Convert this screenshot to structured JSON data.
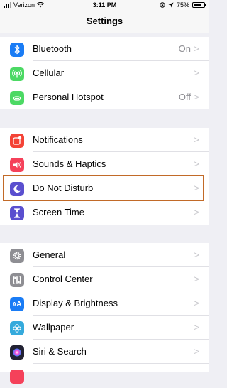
{
  "status_bar": {
    "carrier": "Verizon",
    "time": "3:11 PM",
    "battery_percent": "75%",
    "battery_level": 0.75
  },
  "nav": {
    "title": "Settings"
  },
  "groups": [
    {
      "rows": [
        {
          "label": "Bluetooth",
          "value": "On",
          "icon": "bluetooth-icon",
          "color": "#1a7cf5"
        },
        {
          "label": "Cellular",
          "value": "",
          "icon": "cellular-icon",
          "color": "#4cd964"
        },
        {
          "label": "Personal Hotspot",
          "value": "Off",
          "icon": "hotspot-icon",
          "color": "#4cd964"
        }
      ]
    },
    {
      "rows": [
        {
          "label": "Notifications",
          "value": "",
          "icon": "notifications-icon",
          "color": "#f44336"
        },
        {
          "label": "Sounds & Haptics",
          "value": "",
          "icon": "speaker-icon",
          "color": "#f5415a"
        },
        {
          "label": "Do Not Disturb",
          "value": "",
          "icon": "moon-icon",
          "color": "#5a4fcf"
        },
        {
          "label": "Screen Time",
          "value": "",
          "icon": "hourglass-icon",
          "color": "#5a4fcf"
        }
      ]
    },
    {
      "rows": [
        {
          "label": "General",
          "value": "",
          "icon": "gear-icon",
          "color": "#8e8e93"
        },
        {
          "label": "Control Center",
          "value": "",
          "icon": "toggles-icon",
          "color": "#8e8e93"
        },
        {
          "label": "Display & Brightness",
          "value": "",
          "icon": "text-size-icon",
          "color": "#1a7cf5"
        },
        {
          "label": "Wallpaper",
          "value": "",
          "icon": "flower-icon",
          "color": "#35aadc"
        },
        {
          "label": "Siri & Search",
          "value": "",
          "icon": "siri-icon",
          "color": "#222233"
        }
      ]
    }
  ]
}
